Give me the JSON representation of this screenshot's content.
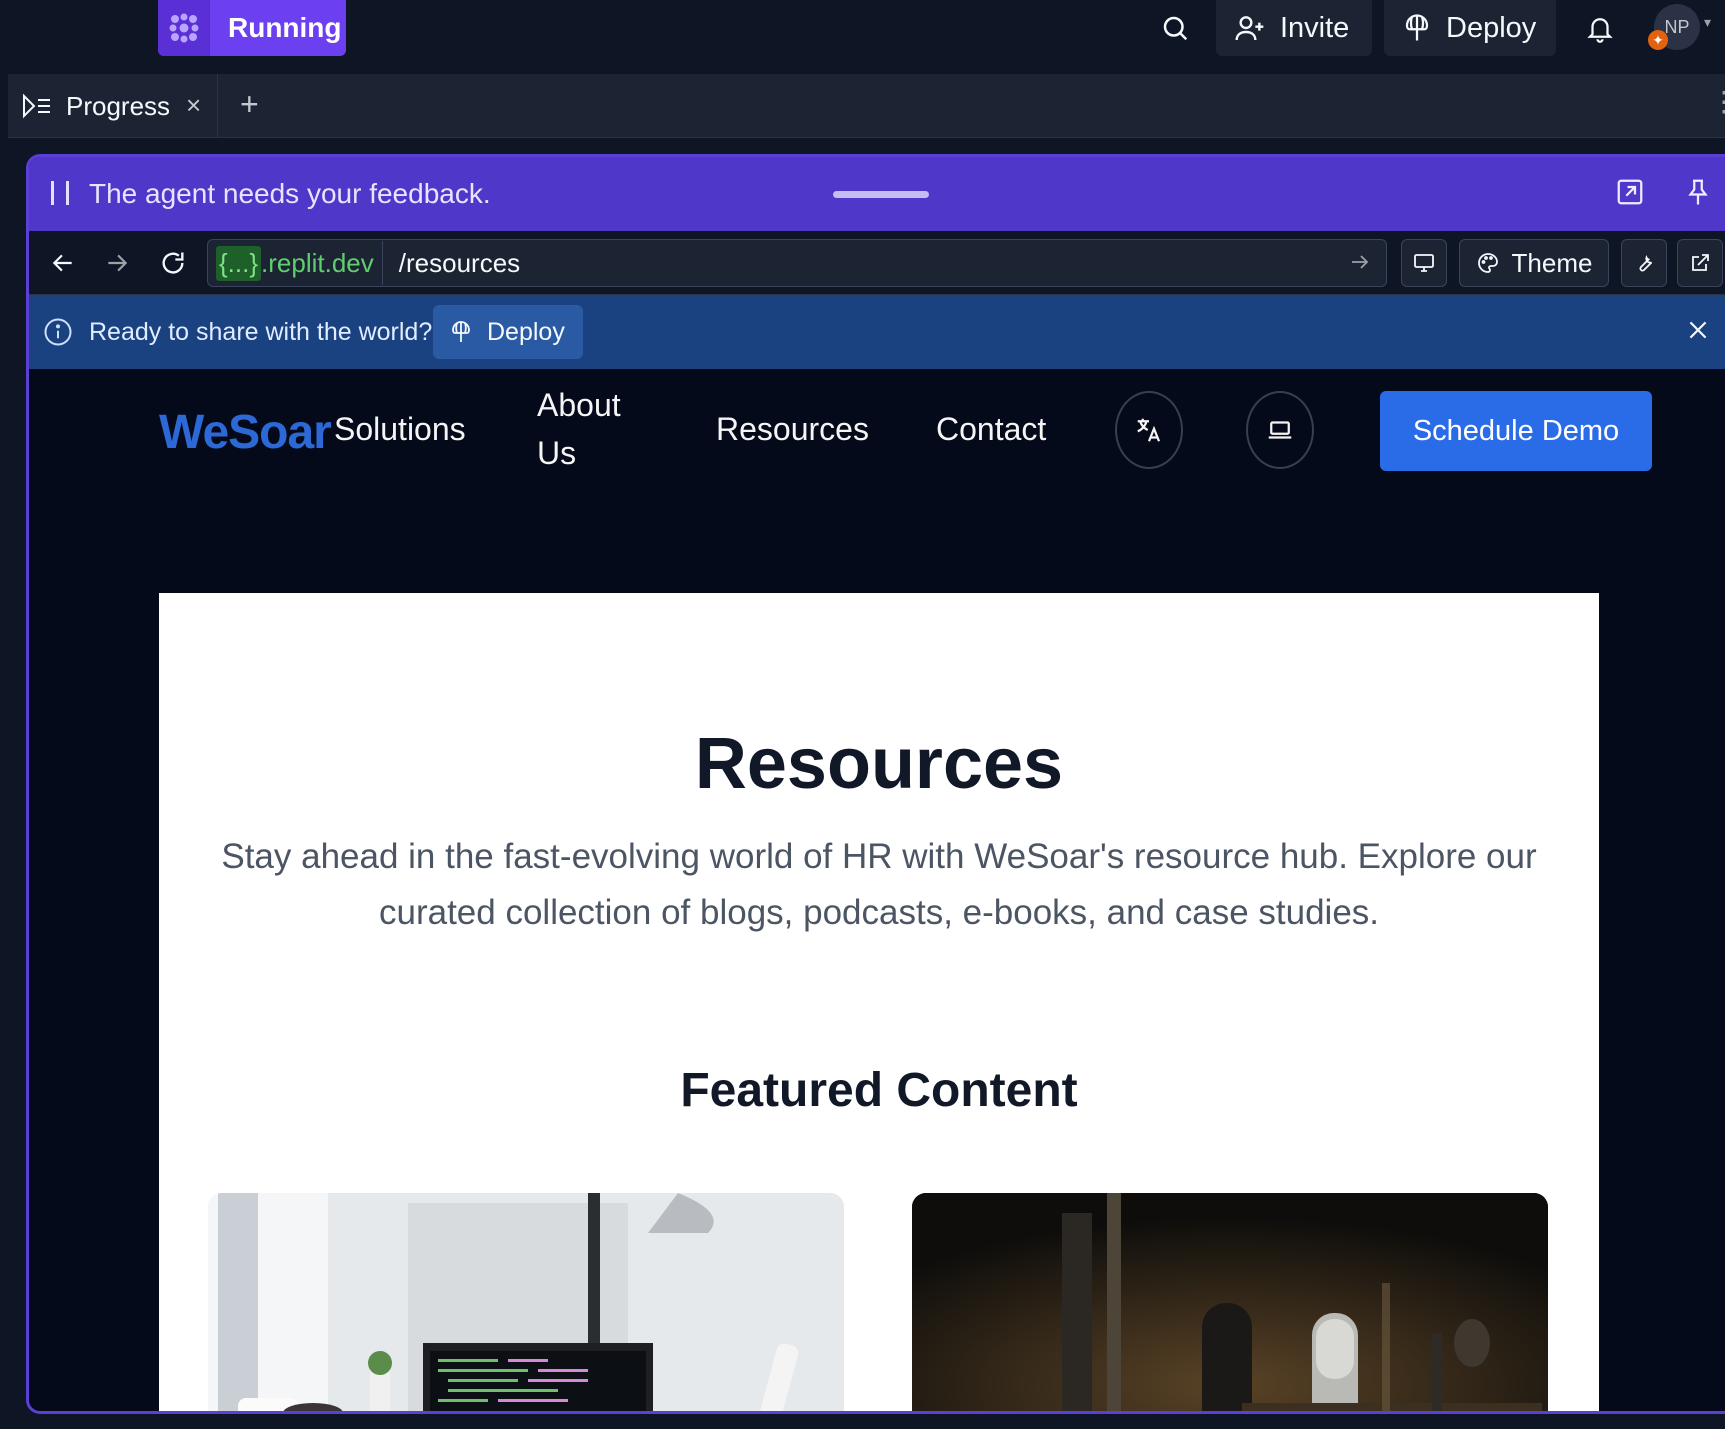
{
  "topbar": {
    "run_label": "Running",
    "invite_label": "Invite",
    "deploy_label": "Deploy",
    "avatar_initials": "NP"
  },
  "tabs": {
    "active_label": "Progress"
  },
  "feedback": {
    "message": "The agent needs your feedback."
  },
  "urlbar": {
    "domain_hidden": "{...}",
    "domain_suffix": ".replit.dev",
    "path": "/resources",
    "theme_label": "Theme"
  },
  "share": {
    "message": "Ready to share with the world?",
    "deploy_label": "Deploy"
  },
  "site": {
    "logo": "WeSoar",
    "nav": {
      "solutions": "Solutions",
      "about_line1": "About",
      "about_line2": "Us",
      "resources": "Resources",
      "contact": "Contact"
    },
    "cta": "Schedule Demo",
    "heading": "Resources",
    "description": "Stay ahead in the fast-evolving world of HR with WeSoar's resource hub. Explore our curated collection of blogs, podcasts, e-books, and case studies.",
    "featured_heading": "Featured Content"
  },
  "colors": {
    "accent_purple": "#4f38c9",
    "brand_blue": "#2d69d6",
    "cta_blue": "#2a6ce8",
    "share_bar": "#1a4280"
  }
}
